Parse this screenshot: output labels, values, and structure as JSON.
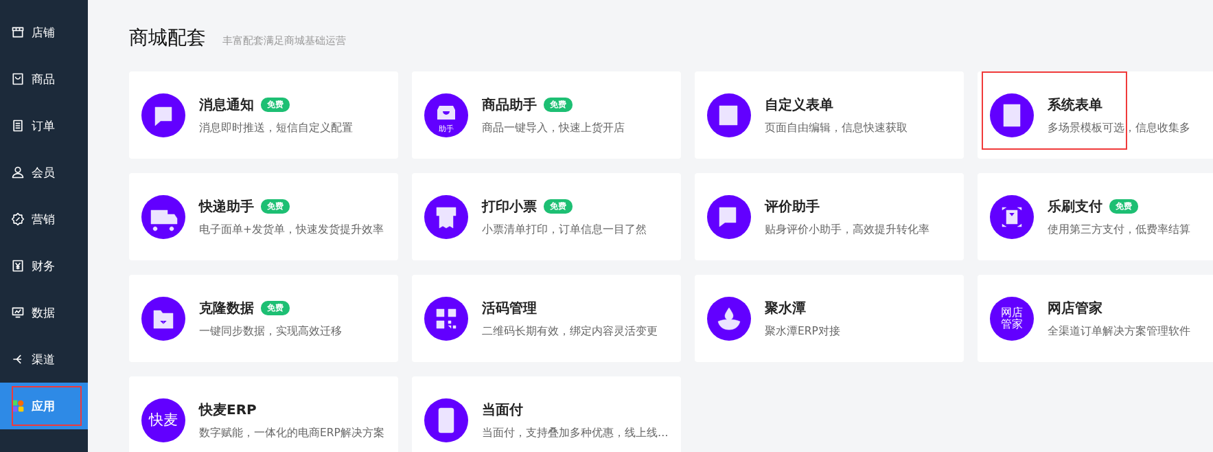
{
  "sidebar": {
    "items": [
      {
        "label": "店铺",
        "selected": false,
        "highlighted": false
      },
      {
        "label": "商品",
        "selected": false,
        "highlighted": false
      },
      {
        "label": "订单",
        "selected": false,
        "highlighted": false
      },
      {
        "label": "会员",
        "selected": false,
        "highlighted": false
      },
      {
        "label": "营销",
        "selected": false,
        "highlighted": false
      },
      {
        "label": "财务",
        "selected": false,
        "highlighted": false
      },
      {
        "label": "数据",
        "selected": false,
        "highlighted": false
      },
      {
        "label": "渠道",
        "selected": false,
        "highlighted": false
      },
      {
        "label": "应用",
        "selected": true,
        "highlighted": true
      }
    ]
  },
  "header": {
    "title": "商城配套",
    "subtitle": "丰富配套满足商城基础运营"
  },
  "cards": [
    {
      "title": "消息通知",
      "badge": "免费",
      "description": "消息即时推送，短信自定义配置",
      "highlighted": false
    },
    {
      "title": "商品助手",
      "badge": "免费",
      "description": "商品一键导入，快速上货开店",
      "icon_text": "助手",
      "highlighted": false
    },
    {
      "title": "自定义表单",
      "description": "页面自由编辑，信息快速获取",
      "highlighted": false
    },
    {
      "title": "系统表单",
      "description": "多场景模板可选，信息收集多",
      "highlighted": true
    },
    {
      "title": "快递助手",
      "badge": "免费",
      "description": "电子面单+发货单，快速发货提升效率",
      "highlighted": false
    },
    {
      "title": "打印小票",
      "badge": "免费",
      "description": "小票清单打印，订单信息一目了然",
      "highlighted": false
    },
    {
      "title": "评价助手",
      "description": "贴身评价小助手，高效提升转化率",
      "highlighted": false
    },
    {
      "title": "乐刷支付",
      "badge": "免费",
      "description": "使用第三方支付，低费率结算",
      "highlighted": false
    },
    {
      "title": "克隆数据",
      "badge": "免费",
      "description": "一键同步数据，实现高效迁移",
      "highlighted": false
    },
    {
      "title": "活码管理",
      "description": "二维码长期有效，绑定内容灵活变更",
      "highlighted": false
    },
    {
      "title": "聚水潭",
      "description": "聚水潭ERP对接",
      "highlighted": false
    },
    {
      "title": "网店管家",
      "description": "全渠道订单解决方案管理软件",
      "icon_text": "网店管家",
      "highlighted": false
    },
    {
      "title": "快麦ERP",
      "description": "数字赋能，一体化的电商ERP解决方案",
      "icon_text": "快麦",
      "highlighted": false
    },
    {
      "title": "当面付",
      "description": "当面付，支持叠加多种优惠，线上线…",
      "highlighted": false
    }
  ]
}
